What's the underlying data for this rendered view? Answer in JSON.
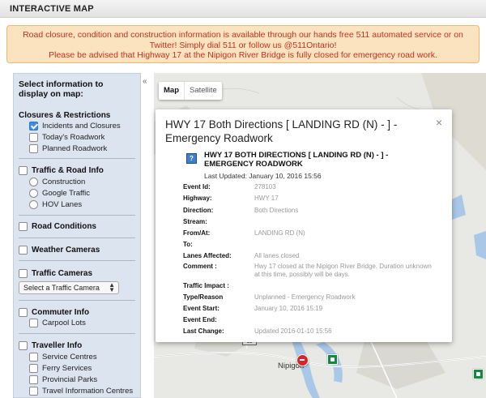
{
  "header": {
    "title": "INTERACTIVE MAP"
  },
  "alert": {
    "line1": "Road closure, condition and construction information is available through our hands free 511 automated service or on",
    "line2": "Twitter! Simply dial 511 or follow us @511Ontario!",
    "line3": "Please be advised that Highway 17 at the Nipigon River Bridge is fully closed for emergency road work."
  },
  "sidebar": {
    "prompt": "Select information to display on map:",
    "collapse": "«",
    "closures": {
      "title": "Closures & Restrictions",
      "items": [
        "Incidents and Closures",
        "Today's Roadwork",
        "Planned Roadwork"
      ],
      "checked": [
        true,
        false,
        false
      ]
    },
    "traffic_road": {
      "title": "Traffic & Road Info",
      "items": [
        "Construction",
        "Google Traffic",
        "HOV Lanes"
      ]
    },
    "road_conditions": "Road Conditions",
    "weather_cameras": "Weather Cameras",
    "traffic_cameras": {
      "title": "Traffic Cameras",
      "select_value": "Select a Traffic Camera"
    },
    "commuter": {
      "title": "Commuter Info",
      "items": [
        "Carpool Lots"
      ]
    },
    "traveller": {
      "title": "Traveller Info",
      "items": [
        "Service Centres",
        "Ferry Services",
        "Provincial Parks",
        "Travel Information Centres"
      ]
    }
  },
  "map": {
    "map_type": [
      "Map",
      "Satellite"
    ],
    "town_label": "Nipigon",
    "road_shield": "11"
  },
  "popup": {
    "title": "HWY 17 Both Directions [ LANDING RD (N) - ] - Emergency Roadwork",
    "close": "×",
    "heading": "HWY 17 BOTH DIRECTIONS [ LANDING RD (N) - ] - EMERGENCY ROADWORK",
    "last_updated": "Last Updated: January 10, 2016 15:56",
    "rows": [
      {
        "label": "Event Id:",
        "value": "278103"
      },
      {
        "label": "Highway:",
        "value": "HWY 17"
      },
      {
        "label": "Direction:",
        "value": "Both Directions"
      },
      {
        "label": "Stream:",
        "value": ""
      },
      {
        "label": "From/At:",
        "value": "LANDING RD (N)"
      },
      {
        "label": "To:",
        "value": ""
      },
      {
        "label": "Lanes Affected:",
        "value": "All lanes closed"
      },
      {
        "label": "Comment :",
        "value": "Hwy 17 closed at the Nipigon River Bridge. Duration unknown at this time, possibly will be days."
      },
      {
        "label": "Traffic Impact :",
        "value": ""
      },
      {
        "label": "Type/Reason",
        "value": "Unplanned - Emergency Roadwork"
      },
      {
        "label": "Event Start:",
        "value": "January 10, 2016 15:19"
      },
      {
        "label": "Event End:",
        "value": ""
      },
      {
        "label": "Last Change:",
        "value": "Updated 2016-01-10 15:56"
      }
    ]
  },
  "colors": {
    "alert_text": "#c3311f",
    "alert_bg": "#fbe3c0",
    "sidebar_bg": "#dbe4ef",
    "checkbox_checked": "#3c8de6",
    "camera_icon": "#128a3d",
    "closure_marker": "#d7262a"
  }
}
